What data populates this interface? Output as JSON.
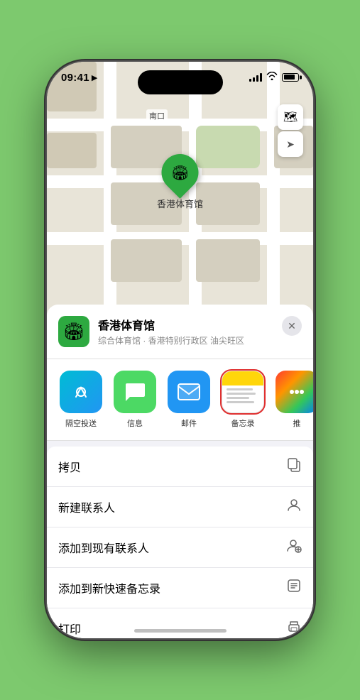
{
  "statusBar": {
    "time": "09:41",
    "timeArrow": "▶"
  },
  "map": {
    "label": "南口",
    "pinLabel": "香港体育馆"
  },
  "mapControls": {
    "mapIcon": "🗺",
    "locationIcon": "➤"
  },
  "locationHeader": {
    "name": "香港体育馆",
    "subtitle": "综合体育馆 · 香港特别行政区 油尖旺区",
    "closeLabel": "✕"
  },
  "shareItems": [
    {
      "id": "airdrop",
      "label": "隔空投送",
      "type": "airdrop"
    },
    {
      "id": "message",
      "label": "信息",
      "type": "message"
    },
    {
      "id": "mail",
      "label": "邮件",
      "type": "mail"
    },
    {
      "id": "notes",
      "label": "备忘录",
      "type": "notes",
      "selected": true
    },
    {
      "id": "more",
      "label": "推",
      "type": "more"
    }
  ],
  "actionItems": [
    {
      "id": "copy",
      "label": "拷贝",
      "icon": "⧉"
    },
    {
      "id": "new-contact",
      "label": "新建联系人",
      "icon": "👤"
    },
    {
      "id": "add-existing",
      "label": "添加到现有联系人",
      "icon": "👤"
    },
    {
      "id": "quick-note",
      "label": "添加到新快速备忘录",
      "icon": "⊞"
    },
    {
      "id": "print",
      "label": "打印",
      "icon": "🖨"
    }
  ]
}
